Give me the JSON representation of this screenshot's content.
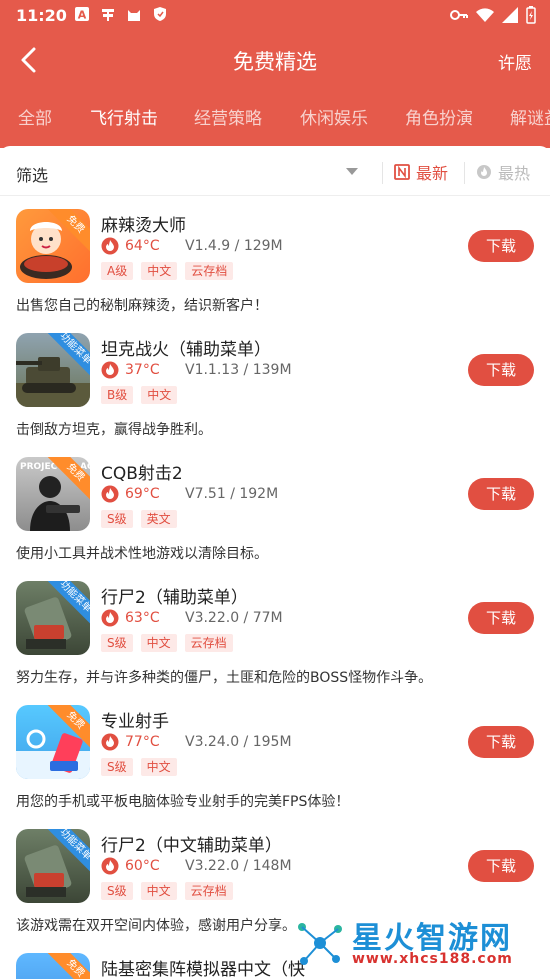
{
  "status_bar": {
    "time": "11:20",
    "left_icons": [
      "a-icon",
      "app-icon",
      "cat-icon",
      "shield-icon"
    ],
    "right_icons": [
      "key-icon",
      "wifi-icon",
      "signal-icon",
      "battery-icon"
    ]
  },
  "nav": {
    "title": "免费精选",
    "right_label": "许愿"
  },
  "tabs": [
    {
      "label": "全部",
      "active": false
    },
    {
      "label": "飞行射击",
      "active": true
    },
    {
      "label": "经营策略",
      "active": false
    },
    {
      "label": "休闲娱乐",
      "active": false
    },
    {
      "label": "角色扮演",
      "active": false
    },
    {
      "label": "解谜益",
      "active": false
    }
  ],
  "filter": {
    "label": "筛选",
    "sort_newest": "最新",
    "sort_hottest": "最热",
    "active_sort": "newest"
  },
  "games": [
    {
      "name": "麻辣烫大师",
      "temp": "64°C",
      "version": "V1.4.9 / 129M",
      "tags": [
        "A级",
        "中文",
        "云存档"
      ],
      "badge": "免费",
      "desc": "出售您自己的秘制麻辣烫，结识新客户！",
      "download": "下载"
    },
    {
      "name": "坦克战火（辅助菜单）",
      "temp": "37°C",
      "version": "V1.1.13 / 139M",
      "tags": [
        "B级",
        "中文"
      ],
      "badge": "功能菜单",
      "desc": "击倒敌方坦克，赢得战争胜利。",
      "download": "下载"
    },
    {
      "name": "CQB射击2",
      "temp": "69°C",
      "version": "V7.51 / 192M",
      "tags": [
        "S级",
        "英文"
      ],
      "badge": "免费",
      "thumb_text": "PROJECT ... ACH",
      "desc": "使用小工具并战术性地游戏以清除目标。",
      "download": "下载"
    },
    {
      "name": "行尸2（辅助菜单）",
      "temp": "63°C",
      "version": "V3.22.0 / 77M",
      "tags": [
        "S级",
        "中文",
        "云存档"
      ],
      "badge": "功能菜单",
      "desc": "努力生存，并与许多种类的僵尸，土匪和危险的BOSS怪物作斗争。",
      "download": "下载"
    },
    {
      "name": "专业射手",
      "temp": "77°C",
      "version": "V3.24.0 / 195M",
      "tags": [
        "S级",
        "中文"
      ],
      "badge": "免费",
      "desc": "用您的手机或平板电脑体验专业射手的完美FPS体验！",
      "download": "下载"
    },
    {
      "name": "行尸2（中文辅助菜单）",
      "temp": "60°C",
      "version": "V3.22.0 / 148M",
      "tags": [
        "S级",
        "中文",
        "云存档"
      ],
      "badge": "功能菜单",
      "desc": "该游戏需在双开空间内体验，感谢用户分享。",
      "download": "下载"
    },
    {
      "name": "陆基密集阵模拟器中文（快",
      "badge": "免费"
    }
  ],
  "watermark": {
    "title": "星火智游网",
    "url": "www.xhcs188.com"
  },
  "colors": {
    "header": "#e55a4b",
    "accent": "#e14f41",
    "tag_bg": "#fde9e7"
  }
}
